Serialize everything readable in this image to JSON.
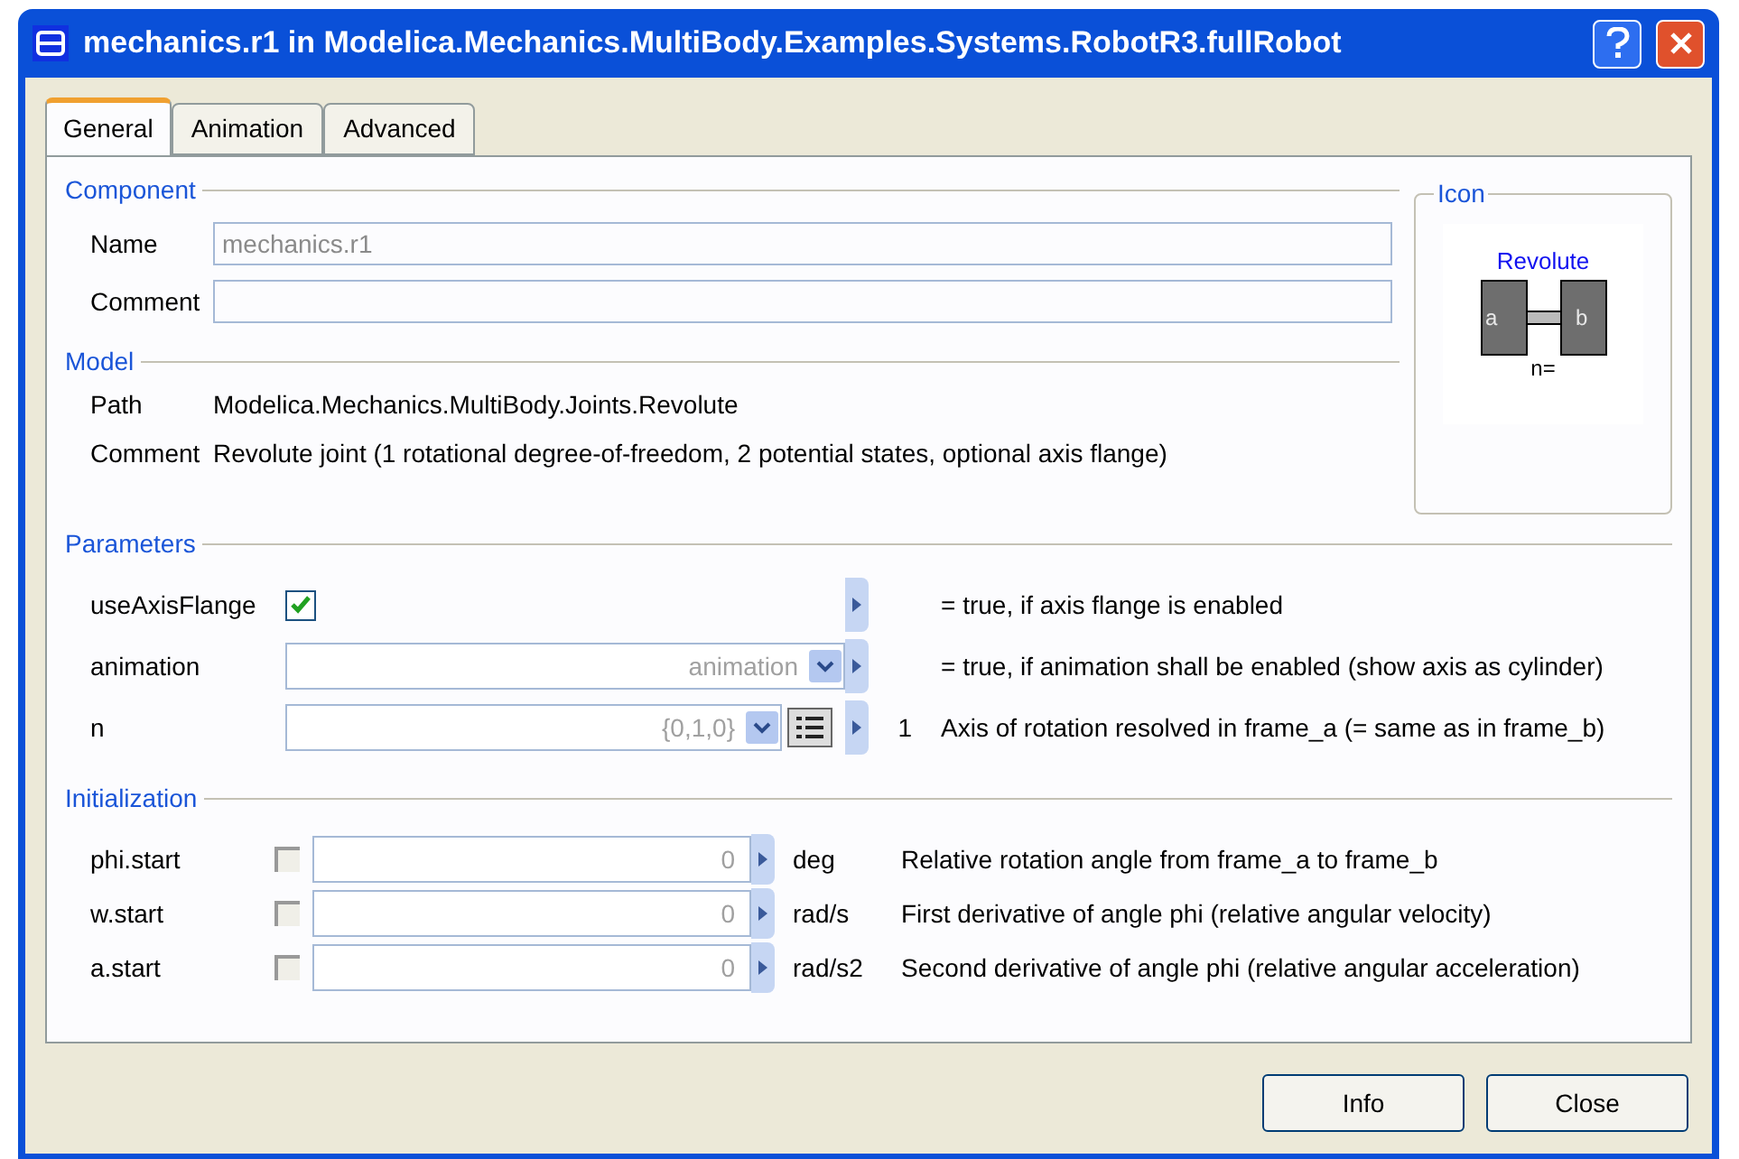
{
  "window": {
    "title": "mechanics.r1 in Modelica.Mechanics.MultiBody.Examples.Systems.RobotR3.fullRobot"
  },
  "tabs": [
    {
      "label": "General",
      "selected": true
    },
    {
      "label": "Animation",
      "selected": false
    },
    {
      "label": "Advanced",
      "selected": false
    }
  ],
  "component": {
    "heading": "Component",
    "name_label": "Name",
    "name_placeholder": "mechanics.r1",
    "comment_label": "Comment"
  },
  "icon": {
    "heading": "Icon",
    "model_name": "Revolute",
    "port_a": "a",
    "port_b": "b",
    "parameter_text": "n="
  },
  "model": {
    "heading": "Model",
    "rows": [
      {
        "label": "Path",
        "value": "Modelica.Mechanics.MultiBody.Joints.Revolute"
      },
      {
        "label": "Comment",
        "value": "Revolute joint (1 rotational degree-of-freedom, 2 potential states, optional axis flange)"
      }
    ]
  },
  "parameters": {
    "heading": "Parameters",
    "rows": [
      {
        "kind": "checkbox",
        "name": "useAxisFlange",
        "checked": true,
        "description": "= true, if axis flange is enabled"
      },
      {
        "kind": "combo",
        "name": "animation",
        "placeholder": "animation",
        "description": "= true, if animation shall be enabled (show axis as cylinder)"
      },
      {
        "kind": "matrix",
        "name": "n",
        "placeholder": "{0,1,0}",
        "unit": "1",
        "description": "Axis of rotation resolved in frame_a (= same as in frame_b)"
      }
    ]
  },
  "initialization": {
    "heading": "Initialization",
    "rows": [
      {
        "name": "phi.start",
        "fixed": false,
        "placeholder": "0",
        "unit": "deg",
        "description": "Relative rotation angle from frame_a to frame_b"
      },
      {
        "name": "w.start",
        "fixed": false,
        "placeholder": "0",
        "unit": "rad/s",
        "description": "First derivative of angle phi (relative angular velocity)"
      },
      {
        "name": "a.start",
        "fixed": false,
        "placeholder": "0",
        "unit": "rad/s2",
        "description": "Second derivative of angle phi (relative angular acceleration)"
      }
    ]
  },
  "buttons": [
    "Info",
    "Close"
  ]
}
